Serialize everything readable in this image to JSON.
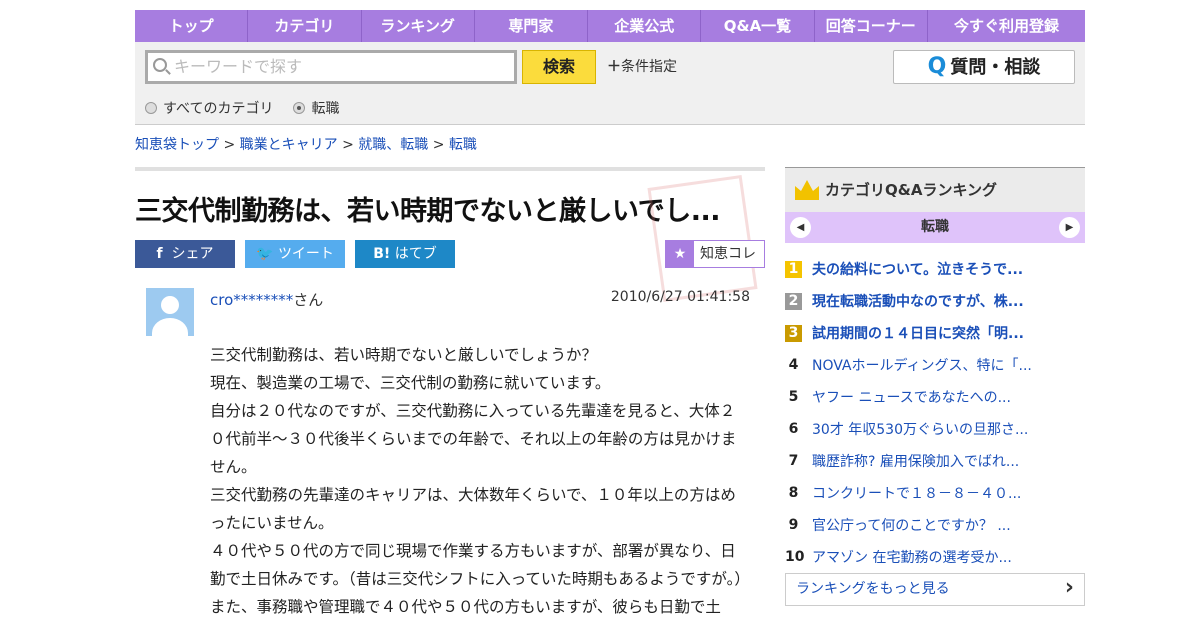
{
  "nav": [
    "トップ",
    "カテゴリ",
    "ランキング",
    "専門家",
    "企業公式",
    "Q&A一覧",
    "回答コーナー",
    "今すぐ利用登録"
  ],
  "search": {
    "placeholder": "キーワードで探す",
    "button": "検索",
    "conditions": "条件指定",
    "ask_button": "質問・相談",
    "radio_all": "すべてのカテゴリ",
    "radio_current": "転職"
  },
  "breadcrumb": [
    "知恵袋トップ",
    "職業とキャリア",
    "就職、転職",
    "転職"
  ],
  "question": {
    "title": "三交代制勤務は、若い時期でないと厳しいでし...",
    "share": "シェア",
    "tweet": "ツイート",
    "hatebu": "はてブ",
    "collect": "知恵コレ",
    "user": "cro********",
    "user_suffix": "さん",
    "date": "2010/6/27  01:41:58",
    "body": [
      "三交代制勤務は、若い時期でないと厳しいでしょうか？",
      "現在、製造業の工場で、三交代制の勤務に就いています。",
      "自分は２０代なのですが、三交代勤務に入っている先輩達を見ると、大体２０代前半～３０代後半くらいまでの年齢で、それ以上の年齢の方は見かけません。",
      "三交代勤務の先輩達のキャリアは、大体数年くらいで、１０年以上の方はめったにいません。",
      "４０代や５０代の方で同じ現場で作業する方もいますが、部署が異なり、日勤で土日休みです。（昔は三交代シフトに入っていた時期もあるようですが。）",
      "また、事務職や管理職で４０代や５０代の方もいますが、彼らも日勤で土"
    ]
  },
  "ranking": {
    "title": "カテゴリQ&Aランキング",
    "category": "転職",
    "more": "ランキングをもっと見る",
    "items": [
      {
        "n": "1",
        "t": "夫の給料について。泣きそうで..."
      },
      {
        "n": "2",
        "t": "現在転職活動中なのですが、株..."
      },
      {
        "n": "3",
        "t": "試用期間の１４日目に突然「明..."
      },
      {
        "n": "4",
        "t": "NOVAホールディングス、特に「..."
      },
      {
        "n": "5",
        "t": "ヤフー ニュースであなたへの..."
      },
      {
        "n": "6",
        "t": "30才 年収530万ぐらいの旦那さ..."
      },
      {
        "n": "7",
        "t": "職歴詐称? 雇用保険加入でばれ..."
      },
      {
        "n": "8",
        "t": "コンクリートで１８－８－４０..."
      },
      {
        "n": "9",
        "t": "官公庁って何のことですか？ ..."
      },
      {
        "n": "10",
        "t": "アマゾン 在宅勤務の選考受か..."
      }
    ]
  }
}
